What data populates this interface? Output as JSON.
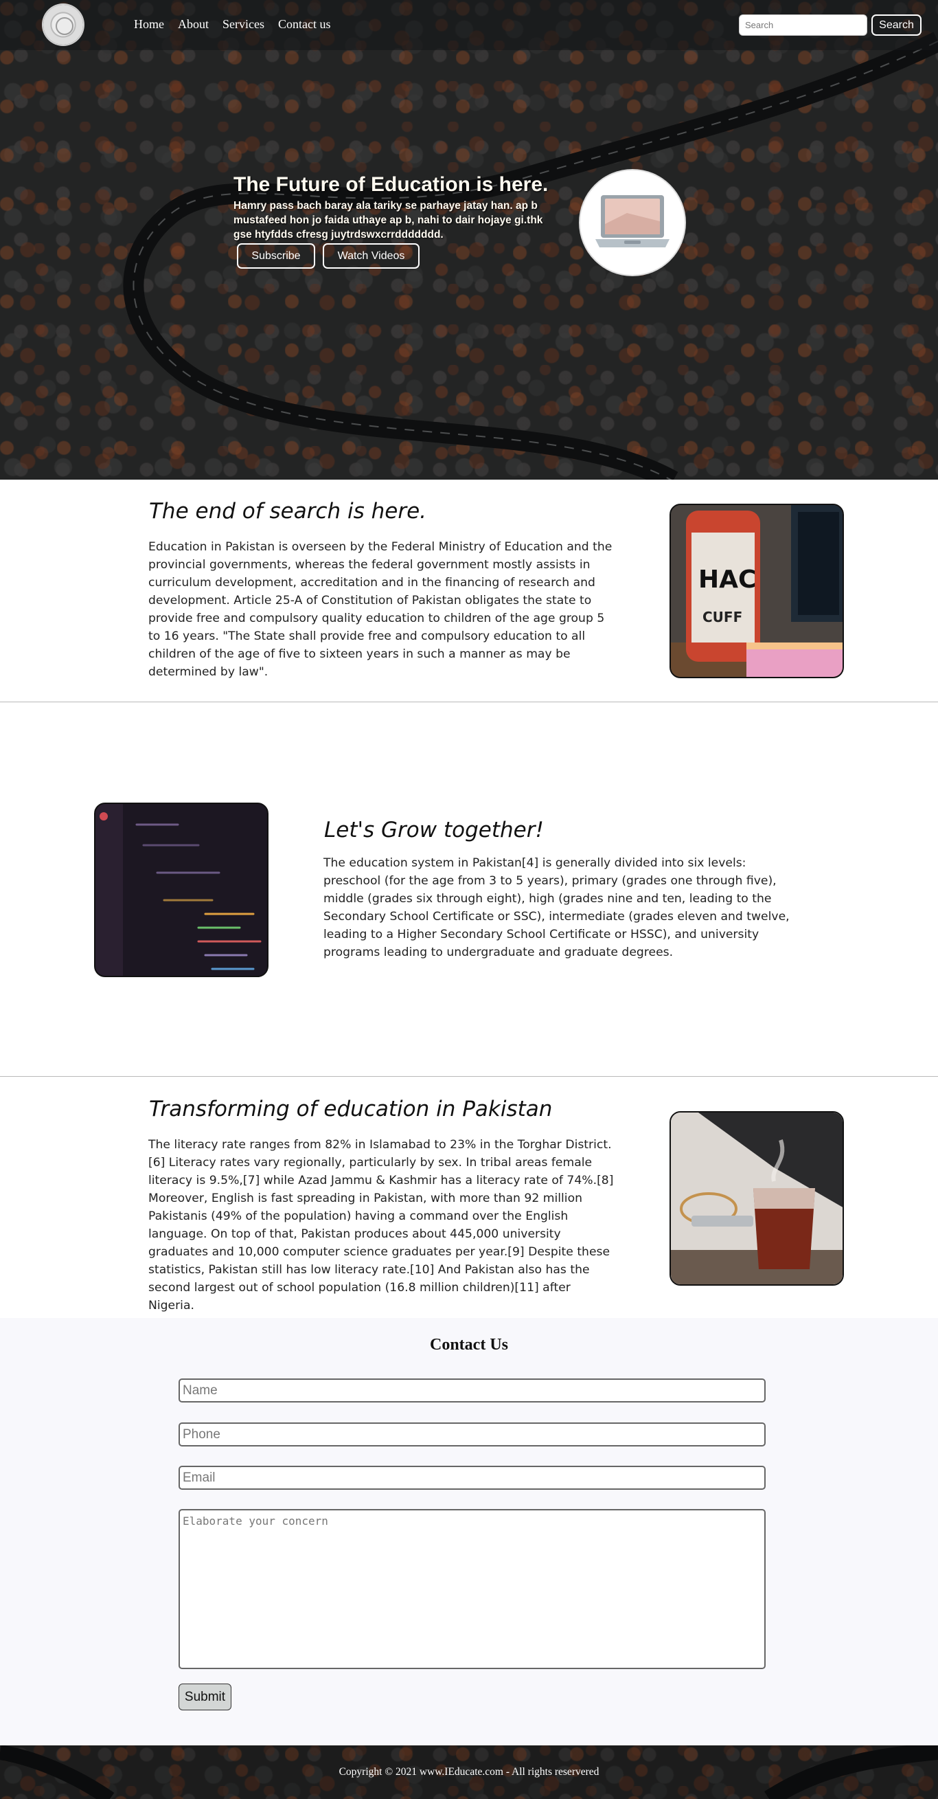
{
  "navbar": {
    "links": [
      "Home",
      "About",
      "Services",
      "Contact us"
    ],
    "search_placeholder": "Search",
    "search_button": "Search"
  },
  "hero": {
    "title": "The Future of Education is here.",
    "text": "Hamry pass bach baray ala tariky se parhaye jatay han. ap b mustafeed hon jo faida uthaye ap b, nahi to dair hojaye gi.thk gse htyfdds cfresg juytrdswxcrrddddddd.",
    "subscribe_button": "Subscribe",
    "watch_button": "Watch Videos"
  },
  "sections": [
    {
      "title": "The end of search is here.",
      "text": "Education in Pakistan is overseen by the Federal Ministry of Education and the provincial governments, whereas the federal government mostly assists in curriculum development, accreditation and in the financing of research and development. Article 25-A of Constitution of Pakistan obligates the state to provide free and compulsory quality education to children of the age group 5 to 16 years. \"The State shall provide free and compulsory education to all children of the age of five to sixteen years in such a manner as may be determined by law\"."
    },
    {
      "title": "Let's Grow together!",
      "text": "The education system in Pakistan[4] is generally divided into six levels: preschool (for the age from 3 to 5 years), primary (grades one through five), middle (grades six through eight), high (grades nine and ten, leading to the Secondary School Certificate or SSC), intermediate (grades eleven and twelve, leading to a Higher Secondary School Certificate or HSSC), and university programs leading to undergraduate and graduate degrees."
    },
    {
      "title": "Transforming of education in Pakistan",
      "text": "The literacy rate ranges from 82% in Islamabad to 23% in the Torghar District.[6] Literacy rates vary regionally, particularly by sex. In tribal areas female literacy is 9.5%,[7] while Azad Jammu & Kashmir has a literacy rate of 74%.[8] Moreover, English is fast spreading in Pakistan, with more than 92 million Pakistanis (49% of the population) having a command over the English language. On top of that, Pakistan produces about 445,000 university graduates and 10,000 computer science graduates per year.[9] Despite these statistics, Pakistan still has low literacy rate.[10] And Pakistan also has the second largest out of school population (16.8 million children)[11] after Nigeria."
    }
  ],
  "contact": {
    "title": "Contact Us",
    "name_placeholder": "Name",
    "phone_placeholder": "Phone",
    "email_placeholder": "Email",
    "message_placeholder": "Elaborate your concern",
    "submit_button": "Submit"
  },
  "footer": {
    "copyright": "Copyright © 2021 www.IEducate.com - All rights reservered"
  },
  "icons": {
    "logo": "seal-logo-icon",
    "hero_avatar": "laptop-icon"
  }
}
